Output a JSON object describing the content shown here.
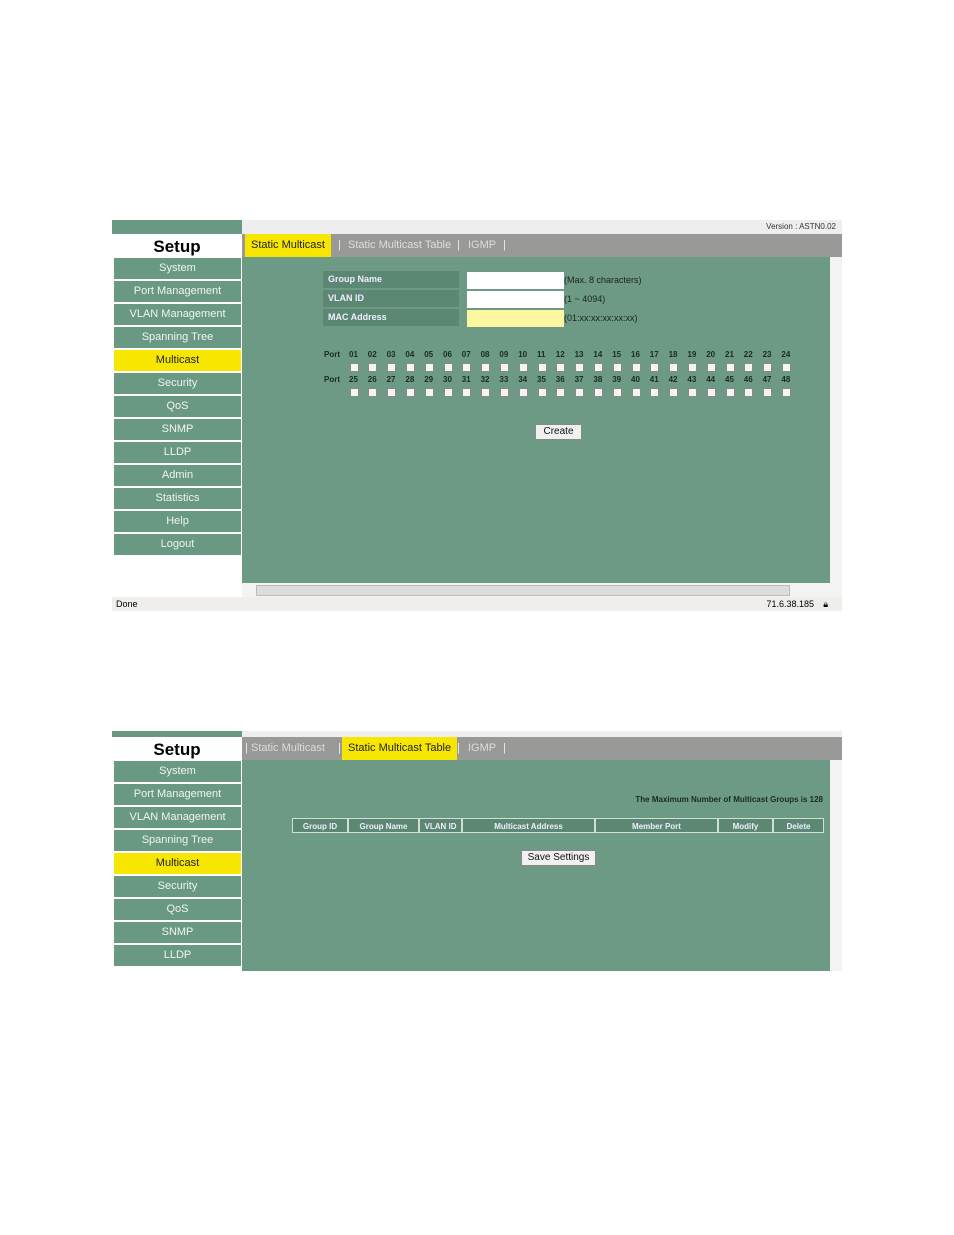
{
  "screen1": {
    "version": "Version :  ASTN0.02",
    "setup": "Setup",
    "sidebar": [
      "System",
      "Port Management",
      "VLAN Management",
      "Spanning Tree",
      "Multicast",
      "Security",
      "QoS",
      "SNMP",
      "LLDP",
      "Admin",
      "Statistics",
      "Help",
      "Logout"
    ],
    "active_item": "Multicast",
    "tabs": [
      "Static Multicast",
      "Static Multicast Table",
      "IGMP"
    ],
    "active_tab": "Static Multicast",
    "separator": "|",
    "form": [
      {
        "label": "Group Name",
        "value": "",
        "hint": "(Max. 8 characters)"
      },
      {
        "label": "VLAN ID",
        "value": "",
        "hint": "(1 ~ 4094)"
      },
      {
        "label": "MAC Address",
        "value": "",
        "hint": "(01:xx:xx:xx:xx:xx)"
      }
    ],
    "port_label": "Port",
    "ports_row1": [
      "01",
      "02",
      "03",
      "04",
      "05",
      "06",
      "07",
      "08",
      "09",
      "10",
      "11",
      "12",
      "13",
      "14",
      "15",
      "16",
      "17",
      "18",
      "19",
      "20",
      "21",
      "22",
      "23",
      "24"
    ],
    "ports_row2": [
      "25",
      "26",
      "27",
      "28",
      "29",
      "30",
      "31",
      "32",
      "33",
      "34",
      "35",
      "36",
      "37",
      "38",
      "39",
      "40",
      "41",
      "42",
      "43",
      "44",
      "45",
      "46",
      "47",
      "48"
    ],
    "create_label": "Create",
    "status": "Done",
    "ip": "71.6.38.185"
  },
  "screen2": {
    "setup": "Setup",
    "sidebar": [
      "System",
      "Port Management",
      "VLAN Management",
      "Spanning Tree",
      "Multicast",
      "Security",
      "QoS",
      "SNMP",
      "LLDP"
    ],
    "active_item": "Multicast",
    "tabs": [
      "Static Multicast",
      "Static Multicast Table",
      "IGMP"
    ],
    "active_tab": "Static Multicast Table",
    "separator": "|",
    "max_text": "The Maximum Number of Multicast Groups is 128",
    "columns": [
      "Group ID",
      "Group Name",
      "VLAN ID",
      "Multicast Address",
      "Member Port",
      "Modify",
      "Delete"
    ],
    "save_label": "Save Settings"
  },
  "colors": {
    "panel": "#6c9a85",
    "highlight": "#f7e600",
    "tabbar": "#999a98"
  }
}
